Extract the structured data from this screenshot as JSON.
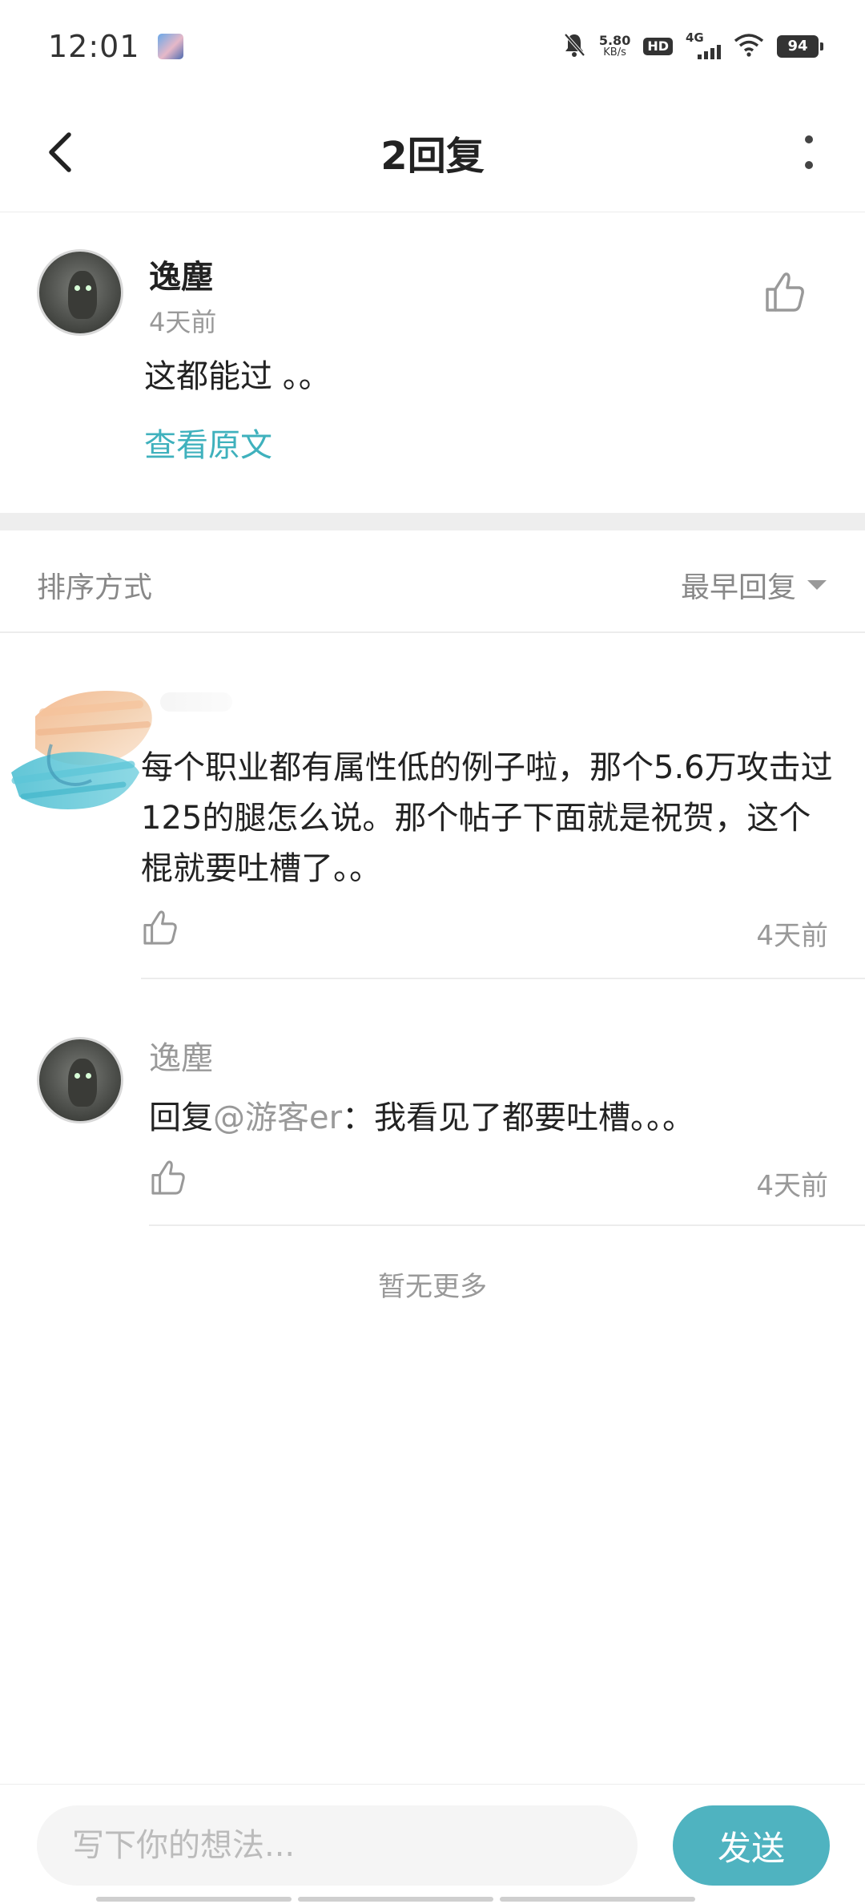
{
  "status_bar": {
    "time": "12:01",
    "net_speed_value": "5.80",
    "net_speed_unit": "KB/s",
    "hd_badge": "HD",
    "network_type": "4G",
    "battery": "94"
  },
  "header": {
    "title": "2回复"
  },
  "main_comment": {
    "author": "逸塵",
    "time": "4天前",
    "text": "这都能过 。。",
    "view_original": "查看原文"
  },
  "sort": {
    "label": "排序方式",
    "selected": "最早回复"
  },
  "replies": [
    {
      "text": "每个职业都有属性低的例子啦，那个5.6万攻击过125的腿怎么说。那个帖子下面就是祝贺，这个棍就要吐槽了。。",
      "time": "4天前"
    },
    {
      "author": "逸塵",
      "reply_prefix": "回复",
      "mention": "@游客er",
      "text": "：我看见了都要吐槽。。。",
      "time": "4天前"
    }
  ],
  "no_more": "暂无更多",
  "composer": {
    "placeholder": "写下你的想法...",
    "send_label": "发送"
  },
  "colors": {
    "accent": "#4fb3c0",
    "link": "#3fb1bd",
    "muted_text": "#999999"
  }
}
